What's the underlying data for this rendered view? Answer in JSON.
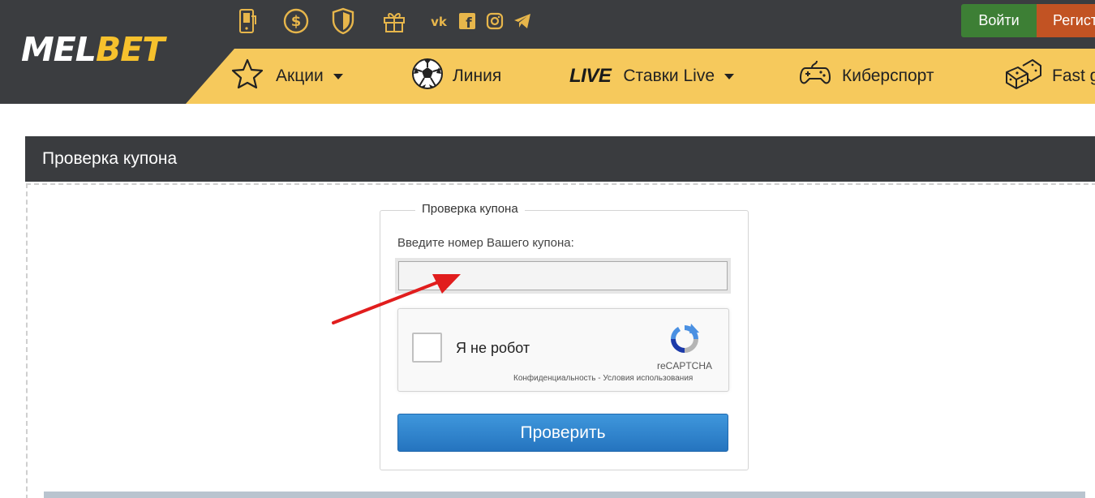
{
  "header": {
    "logo": {
      "part1": "MEL",
      "part2": "BET"
    },
    "icons": [
      "mobile-app-icon",
      "dollar-coin-icon",
      "shield-icon",
      "gift-icon",
      "vk-icon",
      "facebook-icon",
      "instagram-icon",
      "telegram-icon"
    ],
    "login_label": "Войти",
    "register_label": "Регистрация"
  },
  "nav": {
    "items": [
      {
        "label": "Акции",
        "icon": "star-icon",
        "has_dropdown": true
      },
      {
        "label": "Линия",
        "icon": "soccer-ball-icon",
        "has_dropdown": false
      },
      {
        "label": "Ставки Live",
        "badge": "LIVE",
        "has_dropdown": true
      },
      {
        "label": "Киберспорт",
        "icon": "gamepad-icon",
        "has_dropdown": false
      },
      {
        "label": "Fast games",
        "icon": "dice-icon",
        "has_dropdown": false
      }
    ]
  },
  "page": {
    "title": "Проверка купона"
  },
  "form": {
    "legend": "Проверка купона",
    "field_label": "Введите номер Вашего купона:",
    "coupon_value": "",
    "captcha": {
      "label": "Я не робот",
      "brand": "reCAPTCHA",
      "links": "Конфиденциальность - Условия использования"
    },
    "submit_label": "Проверить"
  },
  "colors": {
    "header_bg": "#3b3d40",
    "nav_bg": "#f6c95c",
    "logo_accent": "#f6c12d",
    "login_bg": "#3d7f35",
    "register_bg": "#c25323",
    "submit_bg": "#2f82cc",
    "arrow": "#e11d1d"
  }
}
